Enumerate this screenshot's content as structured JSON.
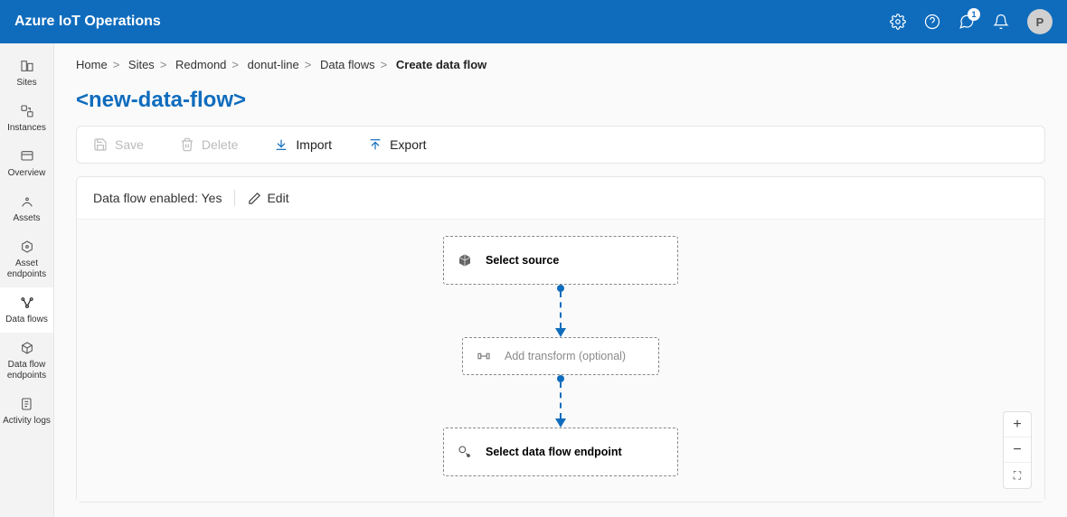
{
  "header": {
    "product_title": "Azure IoT Operations",
    "notification_count": "1",
    "avatar_initial": "P"
  },
  "sidebar": {
    "items": [
      {
        "label": "Sites"
      },
      {
        "label": "Instances"
      },
      {
        "label": "Overview"
      },
      {
        "label": "Assets"
      },
      {
        "label": "Asset endpoints"
      },
      {
        "label": "Data flows"
      },
      {
        "label": "Data flow endpoints"
      },
      {
        "label": "Activity logs"
      }
    ]
  },
  "breadcrumb": {
    "items": [
      "Home",
      "Sites",
      "Redmond",
      "donut-line",
      "Data flows"
    ],
    "current": "Create data flow"
  },
  "page": {
    "title": "<new-data-flow>"
  },
  "toolbar": {
    "save": "Save",
    "delete": "Delete",
    "import": "Import",
    "export": "Export"
  },
  "status": {
    "enabled_label": "Data flow enabled: Yes",
    "edit": "Edit"
  },
  "flow": {
    "source": "Select source",
    "transform": "Add transform (optional)",
    "destination": "Select data flow endpoint"
  },
  "zoom": {
    "in": "+",
    "out": "−",
    "fit": "⛶"
  }
}
